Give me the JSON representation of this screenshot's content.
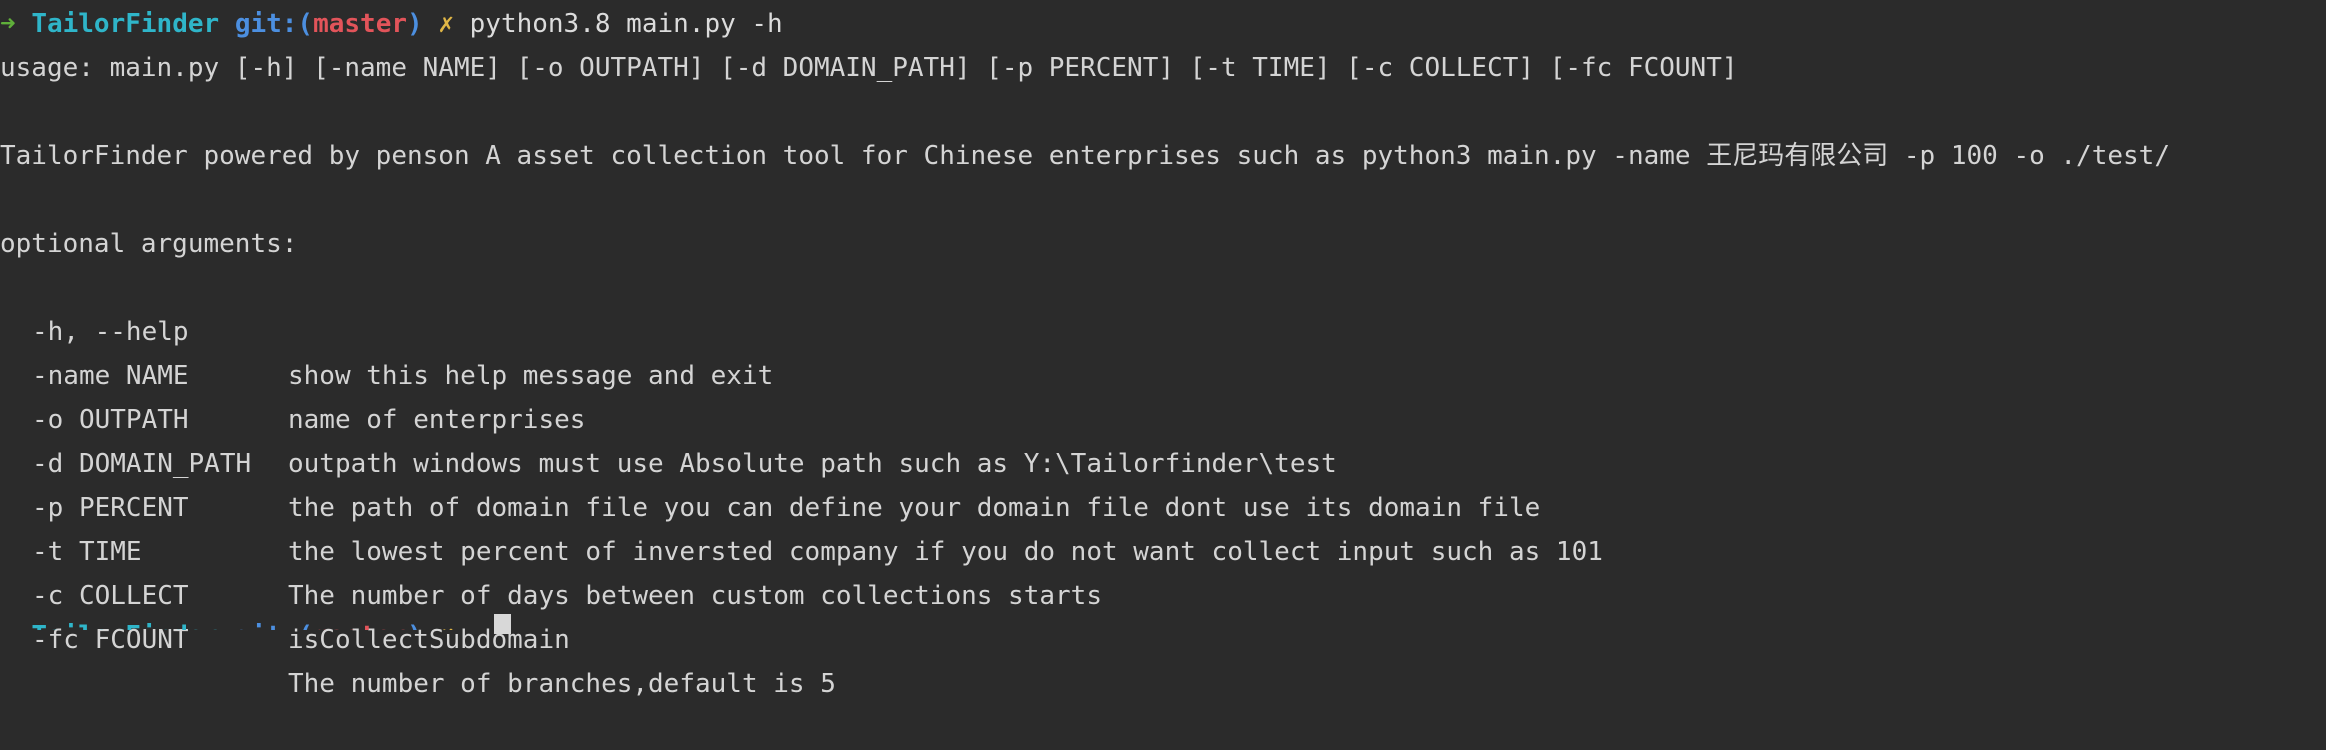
{
  "prompt": {
    "arrow": "➜",
    "directory": "TailorFinder",
    "git_prefix": "git:(",
    "branch": "master",
    "git_suffix": ")",
    "dirty_marker": "✗",
    "command": "python3.8 main.py -h"
  },
  "output": {
    "usage": "usage: main.py [-h] [-name NAME] [-o OUTPATH] [-d DOMAIN_PATH] [-p PERCENT] [-t TIME] [-c COLLECT] [-fc FCOUNT]",
    "description": "TailorFinder powered by penson A asset collection tool for Chinese enterprises such as python3 main.py -name 王尼玛有限公司 -p 100 -o ./test/",
    "section_header": "optional arguments:",
    "options": [
      {
        "flag": "-h, --help",
        "description": "show this help message and exit"
      },
      {
        "flag": "-name NAME",
        "description": "name of enterprises"
      },
      {
        "flag": "-o OUTPATH",
        "description": "outpath windows must use Absolute path such as Y:\\Tailorfinder\\test"
      },
      {
        "flag": "-d DOMAIN_PATH",
        "description": "the path of domain file you can define your domain file dont use its domain file"
      },
      {
        "flag": "-p PERCENT",
        "description": "the lowest percent of inversted company if you do not want collect input such as 101"
      },
      {
        "flag": "-t TIME",
        "description": "The number of days between custom collections starts"
      },
      {
        "flag": "-c COLLECT",
        "description": "isCollectSubdomain"
      },
      {
        "flag": "-fc FCOUNT",
        "description": "The number of branches,default is 5"
      }
    ]
  },
  "colors": {
    "background": "#2b2b2b",
    "text": "#d4d4d4",
    "arrow": "#5faf3a",
    "directory": "#2fb5c9",
    "git": "#4c8fe0",
    "branch": "#e2545a",
    "dirty": "#e0b646"
  }
}
